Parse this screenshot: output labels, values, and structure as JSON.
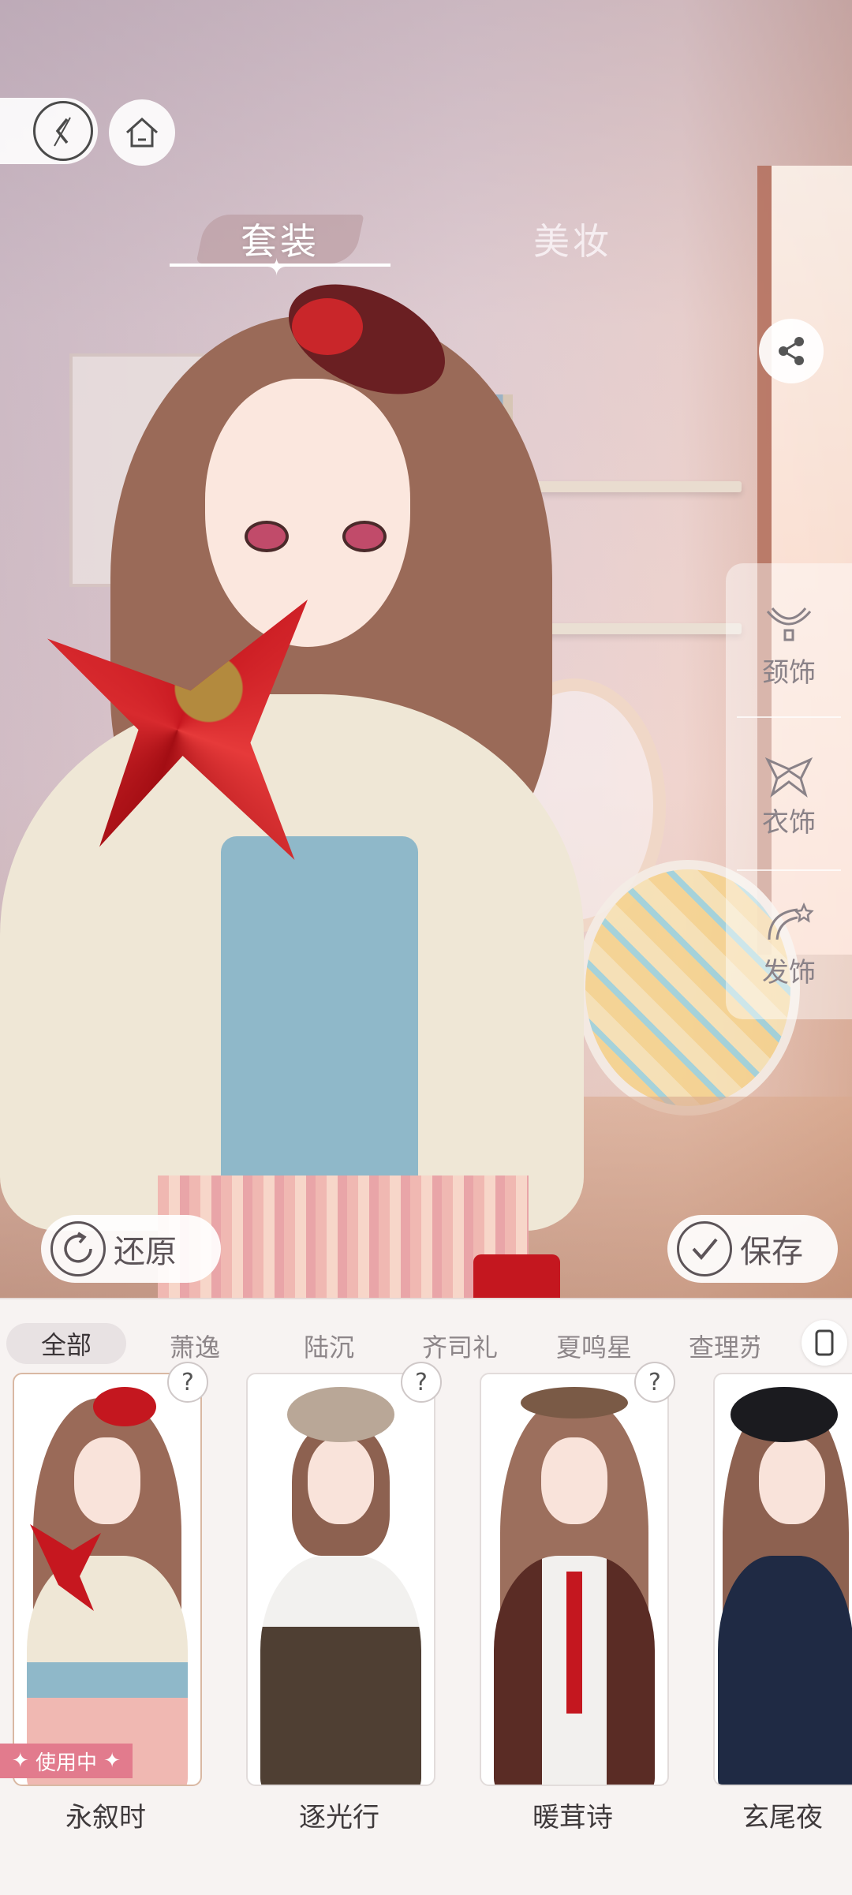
{
  "top_tabs": {
    "outfit": "套装",
    "makeup": "美妆"
  },
  "icons": {
    "back": "back-icon",
    "home": "home-icon",
    "share": "share-icon",
    "necklace": "necklace-icon",
    "clothing_accessory": "bow-tie-icon",
    "hair_accessory": "hair-clip-icon",
    "restore": "restore-icon",
    "save": "check-icon",
    "view_toggle": "phone-view-icon",
    "help": "question-icon"
  },
  "accessories": {
    "necklace_label": "颈饰",
    "clothing_label": "衣饰",
    "hair_label": "发饰"
  },
  "actions": {
    "restore": "还原",
    "save": "保存"
  },
  "filters": [
    "全部",
    "萧逸",
    "陆沉",
    "齐司礼",
    "夏鸣星",
    "查理苏"
  ],
  "cards": [
    {
      "name": "永叙时",
      "status": "使用中",
      "help": "?"
    },
    {
      "name": "逐光行",
      "help": "?"
    },
    {
      "name": "暖茸诗",
      "help": "?"
    },
    {
      "name": "玄尾夜"
    }
  ],
  "colors": {
    "in_use_badge": "#e27b8d",
    "panel_bg": "#f7f3f2",
    "text_dark": "#3f3a3c"
  }
}
